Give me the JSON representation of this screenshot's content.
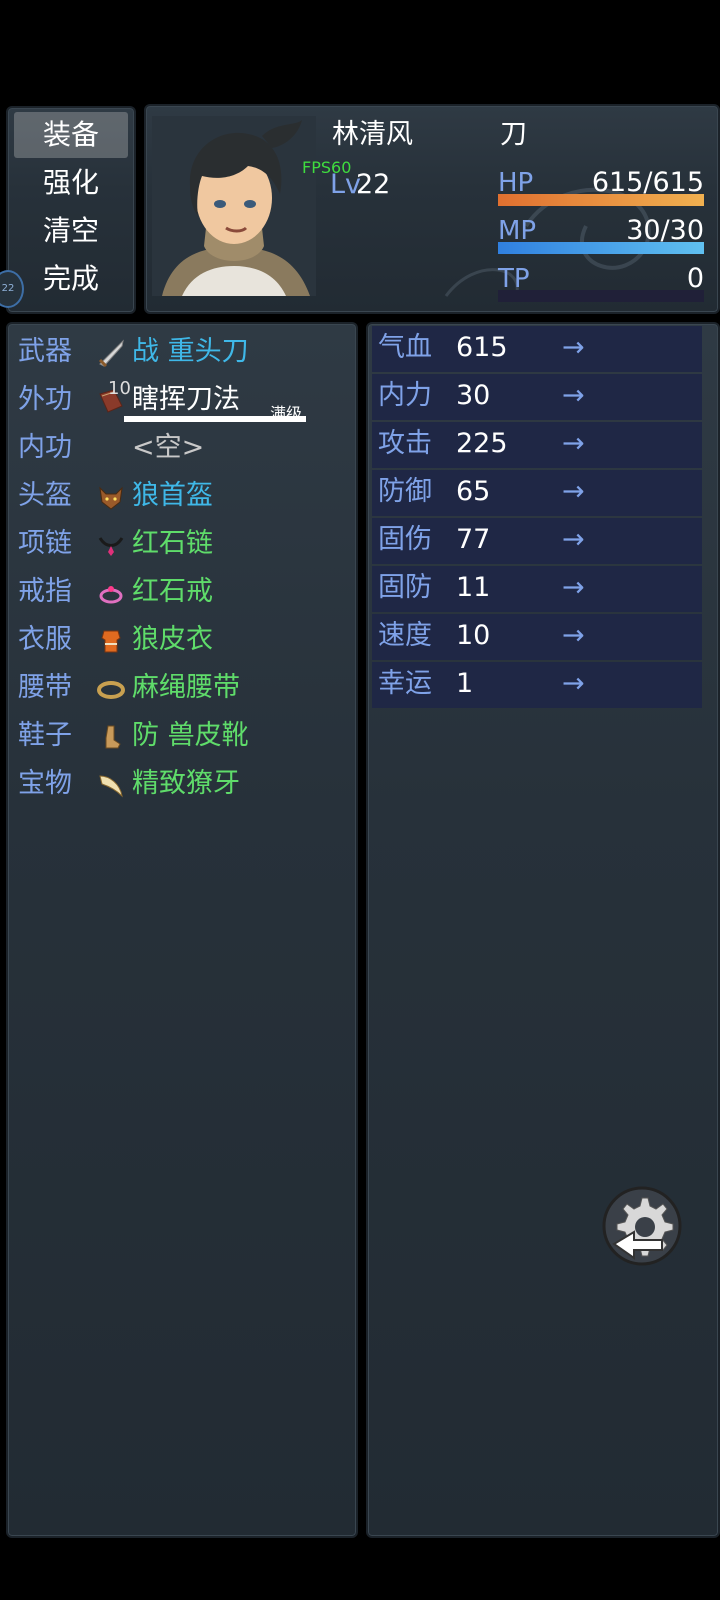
{
  "commands": [
    {
      "label": "装备",
      "selected": true
    },
    {
      "label": "强化",
      "selected": false
    },
    {
      "label": "清空",
      "selected": false
    },
    {
      "label": "完成",
      "selected": false
    }
  ],
  "side_badge": "22",
  "actor": {
    "name": "林清风",
    "class": "刀",
    "level_label": "Lv",
    "level": "22",
    "fps": "FPS60",
    "hp": {
      "label": "HP",
      "value": "615/615",
      "ratio": 1.0
    },
    "mp": {
      "label": "MP",
      "value": "30/30",
      "ratio": 1.0
    },
    "tp": {
      "label": "TP",
      "value": "0",
      "ratio": 0.0
    }
  },
  "equipment": [
    {
      "slot": "武器",
      "icon": "sword-icon",
      "name": "战 重头刀",
      "color": "#3fb8e8"
    },
    {
      "slot": "外功",
      "icon": "book-icon",
      "name": "瞎挥刀法",
      "color": "#ffffff",
      "badge": "10",
      "note": "满级"
    },
    {
      "slot": "内功",
      "icon": "",
      "name": "<空>",
      "color": "#c8c8c8"
    },
    {
      "slot": "头盔",
      "icon": "wolf-helm-icon",
      "name": "狼首盔",
      "color": "#3fb8e8"
    },
    {
      "slot": "项链",
      "icon": "necklace-icon",
      "name": "红石链",
      "color": "#5fdc6a"
    },
    {
      "slot": "戒指",
      "icon": "ring-icon",
      "name": "红石戒",
      "color": "#5fdc6a"
    },
    {
      "slot": "衣服",
      "icon": "armor-icon",
      "name": "狼皮衣",
      "color": "#5fdc6a"
    },
    {
      "slot": "腰带",
      "icon": "belt-icon",
      "name": "麻绳腰带",
      "color": "#5fdc6a"
    },
    {
      "slot": "鞋子",
      "icon": "boot-icon",
      "name": "防 兽皮靴",
      "color": "#5fdc6a"
    },
    {
      "slot": "宝物",
      "icon": "fang-icon",
      "name": "精致獠牙",
      "color": "#5fdc6a"
    }
  ],
  "params": [
    {
      "name": "气血",
      "value": "615",
      "arrow": "→"
    },
    {
      "name": "内力",
      "value": "30",
      "arrow": "→"
    },
    {
      "name": "攻击",
      "value": "225",
      "arrow": "→"
    },
    {
      "name": "防御",
      "value": "65",
      "arrow": "→"
    },
    {
      "name": "固伤",
      "value": "77",
      "arrow": "→"
    },
    {
      "name": "固防",
      "value": "11",
      "arrow": "→"
    },
    {
      "name": "速度",
      "value": "10",
      "arrow": "→"
    },
    {
      "name": "幸运",
      "value": "1",
      "arrow": "→"
    }
  ],
  "colors": {
    "system_blue": "#7fa2e8",
    "hp_gauge": "#f0a040",
    "mp_gauge": "#4fb0f0",
    "tp_gauge": "#202038"
  }
}
